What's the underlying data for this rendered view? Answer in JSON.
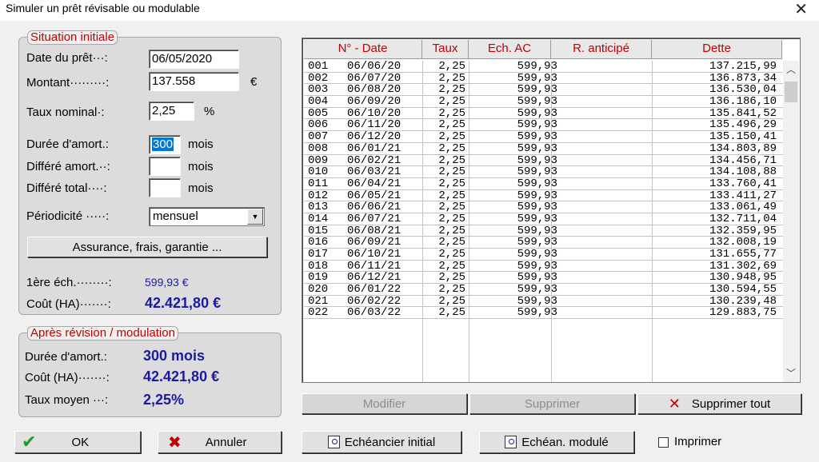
{
  "window": {
    "title": "Simuler un prêt révisable ou modulable",
    "close": "✕"
  },
  "situation": {
    "legend": "Situation initiale",
    "date_label": "Date du prêt···:",
    "date_value": "06/05/2020",
    "montant_label": "Montant·········:",
    "montant_value": "137.558",
    "montant_unit": "€",
    "taux_label": "Taux nominal·:",
    "taux_value": "2,25",
    "taux_unit": "%",
    "duree_label": "Durée d'amort.:",
    "duree_value": "300",
    "duree_unit": "mois",
    "differe_amort_label": "Différé amort.··:",
    "differe_amort_unit": "mois",
    "differe_total_label": "Différé total····:",
    "differe_total_unit": "mois",
    "periodicite_label": "Périodicité ·····:",
    "periodicite_value": "mensuel",
    "assurance_button": "Assurance, frais, garantie ...",
    "first_label": "1ère éch.········:",
    "first_value": "599,93 €",
    "cout_label": "Coût (HA)·······:",
    "cout_value": "42.421,80 €"
  },
  "revision": {
    "legend": "Après révision / modulation",
    "duree_label": "Durée d'amort.:",
    "duree_value": "300 mois",
    "cout_label": "Coût (HA)·······:",
    "cout_value": "42.421,80 €",
    "taux_label": "Taux moyen ···:",
    "taux_value": "2,25%"
  },
  "table": {
    "headers": [
      "N° - Date",
      "Taux",
      "Ech. AC",
      "R. anticipé",
      "Dette"
    ],
    "rows": [
      [
        "001",
        "06/06/20",
        "2,25",
        "599,93",
        "137.215,99"
      ],
      [
        "002",
        "06/07/20",
        "2,25",
        "599,93",
        "136.873,34"
      ],
      [
        "003",
        "06/08/20",
        "2,25",
        "599,93",
        "136.530,04"
      ],
      [
        "004",
        "06/09/20",
        "2,25",
        "599,93",
        "136.186,10"
      ],
      [
        "005",
        "06/10/20",
        "2,25",
        "599,93",
        "135.841,52"
      ],
      [
        "006",
        "06/11/20",
        "2,25",
        "599,93",
        "135.496,29"
      ],
      [
        "007",
        "06/12/20",
        "2,25",
        "599,93",
        "135.150,41"
      ],
      [
        "008",
        "06/01/21",
        "2,25",
        "599,93",
        "134.803,89"
      ],
      [
        "009",
        "06/02/21",
        "2,25",
        "599,93",
        "134.456,71"
      ],
      [
        "010",
        "06/03/21",
        "2,25",
        "599,93",
        "134.108,88"
      ],
      [
        "011",
        "06/04/21",
        "2,25",
        "599,93",
        "133.760,41"
      ],
      [
        "012",
        "06/05/21",
        "2,25",
        "599,93",
        "133.411,27"
      ],
      [
        "013",
        "06/06/21",
        "2,25",
        "599,93",
        "133.061,49"
      ],
      [
        "014",
        "06/07/21",
        "2,25",
        "599,93",
        "132.711,04"
      ],
      [
        "015",
        "06/08/21",
        "2,25",
        "599,93",
        "132.359,95"
      ],
      [
        "016",
        "06/09/21",
        "2,25",
        "599,93",
        "132.008,19"
      ],
      [
        "017",
        "06/10/21",
        "2,25",
        "599,93",
        "131.655,77"
      ],
      [
        "018",
        "06/11/21",
        "2,25",
        "599,93",
        "131.302,69"
      ],
      [
        "019",
        "06/12/21",
        "2,25",
        "599,93",
        "130.948,95"
      ],
      [
        "020",
        "06/01/22",
        "2,25",
        "599,93",
        "130.594,55"
      ],
      [
        "021",
        "06/02/22",
        "2,25",
        "599,93",
        "130.239,48"
      ],
      [
        "022",
        "06/03/22",
        "2,25",
        "599,93",
        "129.883,75"
      ]
    ]
  },
  "actions": {
    "modifier": "Modifier",
    "supprimer": "Supprimer",
    "supprimer_tout": "Supprimer tout",
    "ok": "OK",
    "annuler": "Annuler",
    "echeancier_initial": "Echéancier initial",
    "echean_module": "Echéan. modulé",
    "imprimer": "Imprimer"
  },
  "colors": {
    "legend": "#c00000",
    "value_blue": "#1a1aa0",
    "ok_check": "#1e9e1e",
    "cancel_x": "#c00000"
  }
}
